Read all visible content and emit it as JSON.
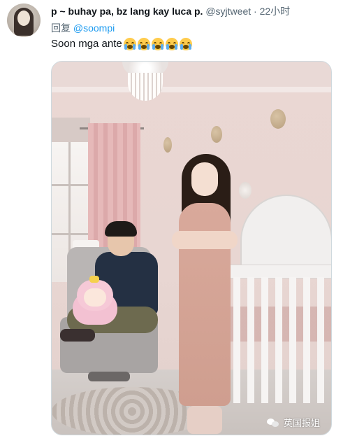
{
  "author": {
    "name": "p ~ buhay pa, bz lang kay luca p.",
    "handle": "@syjtweet",
    "separator": "·",
    "timestamp": "22小时"
  },
  "reply": {
    "prefix": "回复",
    "mention": "@soompi"
  },
  "tweet": {
    "text": "Soon mga ante",
    "emoji_icon": "loudly-crying-face",
    "emoji_count": 5
  },
  "media": {
    "watermark": "英国报姐",
    "watermark_icon": "wechat-icon"
  },
  "colors": {
    "mention": "#1d9bf0",
    "secondary_text": "#536471",
    "primary_text": "#0f1419"
  }
}
